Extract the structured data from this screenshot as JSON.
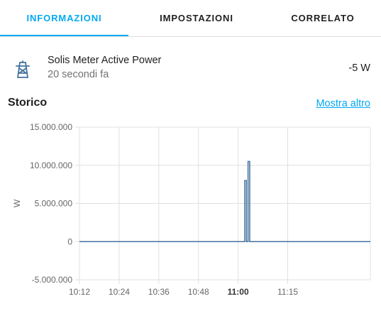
{
  "tabs": [
    {
      "label": "INFORMAZIONI",
      "active": true
    },
    {
      "label": "IMPOSTAZIONI",
      "active": false
    },
    {
      "label": "CORRELATO",
      "active": false
    }
  ],
  "entity": {
    "icon": "transmission-tower-icon",
    "name": "Solis Meter Active Power",
    "last_changed": "20 secondi fa",
    "state": "-5 W"
  },
  "history": {
    "title": "Storico",
    "show_more_label": "Mostra altro"
  },
  "colors": {
    "accent": "#03a9f4",
    "series_line": "#44739e",
    "icon": "#44739e"
  },
  "chart_data": {
    "type": "line",
    "title": "",
    "xlabel": "",
    "ylabel": "W",
    "ylim": [
      -5000000,
      15000000
    ],
    "y_ticks": [
      15000000,
      10000000,
      5000000,
      0,
      -5000000
    ],
    "y_tick_labels": [
      "15.000.000",
      "10.000.000",
      "5.000.000",
      "0",
      "-5.000.000"
    ],
    "x_ticks": [
      "10:12",
      "10:24",
      "10:36",
      "10:48",
      "11:00",
      "11:15"
    ],
    "x_ticks_bold": [
      "11:00"
    ],
    "x_range": [
      "10:12",
      "11:40"
    ],
    "grid": true,
    "series": [
      {
        "step": true,
        "x": [
          "10:12",
          "11:02",
          "11:02",
          "11:02.5",
          "11:02.5",
          "11:03",
          "11:03",
          "11:03.5",
          "11:03.5",
          "11:40"
        ],
        "y": [
          0,
          0,
          8000000,
          8000000,
          0,
          0,
          10500000,
          10500000,
          -5,
          -5
        ]
      }
    ]
  }
}
